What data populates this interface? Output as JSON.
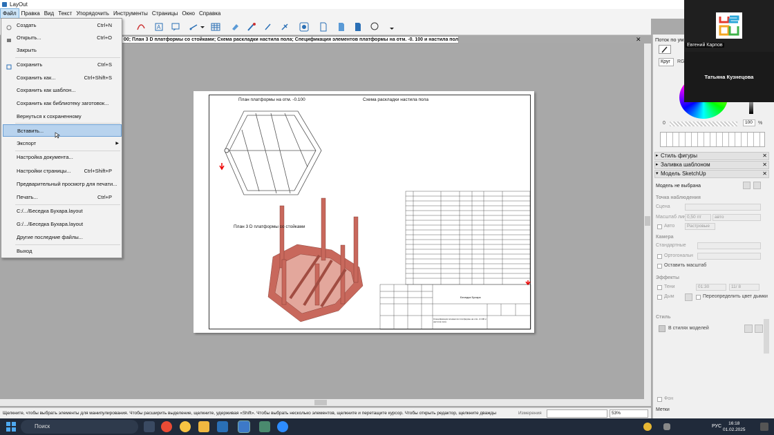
{
  "window": {
    "title": "LayOut"
  },
  "menubar": {
    "items": [
      "Файл",
      "Правка",
      "Вид",
      "Текст",
      "Упорядочить",
      "Инструменты",
      "Страницы",
      "Окно",
      "Справка"
    ]
  },
  "document_tab": {
    "title": "00; План 3 D платформы со стойками; Схема раскладки настила пола; Спецификация элементов платформы на отм. -0. 100 и настила пола",
    "close_label": "✕"
  },
  "file_menu": {
    "items": [
      {
        "label": "Создать",
        "shortcut": "Ctrl+N",
        "icon": "new-document-icon"
      },
      {
        "label": "Открыть...",
        "shortcut": "Ctrl+O",
        "icon": "open-folder-icon"
      },
      {
        "label": "Закрыть",
        "shortcut": ""
      },
      {
        "label": "Сохранить",
        "shortcut": "Ctrl+S",
        "icon": "save-icon"
      },
      {
        "label": "Сохранить как...",
        "shortcut": "Ctrl+Shift+S"
      },
      {
        "label": "Сохранить как шаблон...",
        "shortcut": ""
      },
      {
        "label": "Сохранить как библиотеку заготовок...",
        "shortcut": ""
      },
      {
        "label": "Вернуться к сохраненному",
        "shortcut": ""
      },
      {
        "label": "Вставить...",
        "shortcut": "",
        "highlighted": true
      },
      {
        "label": "Экспорт",
        "shortcut": "",
        "submenu": true
      },
      {
        "label": "Настройка документа...",
        "shortcut": ""
      },
      {
        "label": "Настройки страницы...",
        "shortcut": "Ctrl+Shift+P"
      },
      {
        "label": "Предварительный просмотр для печати...",
        "shortcut": ""
      },
      {
        "label": "Печать...",
        "shortcut": "Ctrl+P"
      },
      {
        "label": "C:/.../Беседка Бухара.layout",
        "shortcut": ""
      },
      {
        "label": "G:/.../Беседка Бухара.layout",
        "shortcut": ""
      },
      {
        "label": "Другие последние файлы...",
        "shortcut": ""
      },
      {
        "label": "Выход",
        "shortcut": ""
      }
    ]
  },
  "drawing": {
    "title_plan": "План платформы на отм. -0.100",
    "title_scheme": "Схема раскладки настила пола",
    "title_3d": "План 3 D платформы со стойками",
    "stamp_name": "Беседка Бухара",
    "stamp_note": "Спецификация элементов платформы на отм. -0.100 и настила пола"
  },
  "statusbar": {
    "message": "Щелкните, чтобы выбрать элементы для манипулирования. Чтобы расширить выделение, щелкните, удерживая «Shift». Чтобы выбрать несколько элементов, щелкните и перетащите курсор. Чтобы открыть редактор, щелкните дважды",
    "measure_label": "Измерения",
    "zoom": "53%"
  },
  "right_panel": {
    "color_panel_title": "Поток по ум",
    "color_tab_circle": "Круг",
    "color_tab_rgb": "RG",
    "opacity_zero": "0",
    "opacity_value": "100",
    "opacity_unit": "%",
    "shape_style": "Стиль фигуры",
    "pattern_fill": "Заливка шаблоном",
    "sketchup_model": "Модель SketchUp",
    "model_status": "Модель не выбрана",
    "viewpoint": "Точка наблюдения",
    "scene": "Сцена",
    "line_scale": "Масштаб линии",
    "line_scale_value": "0,50 пт",
    "auto_label": "авто",
    "auto_cb": "Авто",
    "raster": "Растровые",
    "camera": "Камера",
    "standard": "Стандартные",
    "orthographic": "Ортогональн",
    "keep_scale": "Оставить масштаб",
    "effects": "Эффекты",
    "shadows": "Тени",
    "shadows_time": "01:30",
    "shadows_date": "11/ 8",
    "fog": "Дым",
    "override_color": "Переопределить цвет дымки",
    "style": "Стиль",
    "in_model_styles": "В стилях моделей",
    "background": "Фон",
    "labels": "Метки",
    "close_glyph": "✕"
  },
  "video": {
    "participant_1": "Евгений Карпов",
    "participant_2": "Татьяна Кузнецова"
  },
  "taskbar": {
    "search_placeholder": "Поиск",
    "language": "РУС",
    "time": "16:18",
    "date": "01.02.2025"
  },
  "colors": {
    "accent_highlight": "#b8d3ee",
    "timber_red": "#c8685c",
    "taskbar_bg": "#202a3a"
  }
}
